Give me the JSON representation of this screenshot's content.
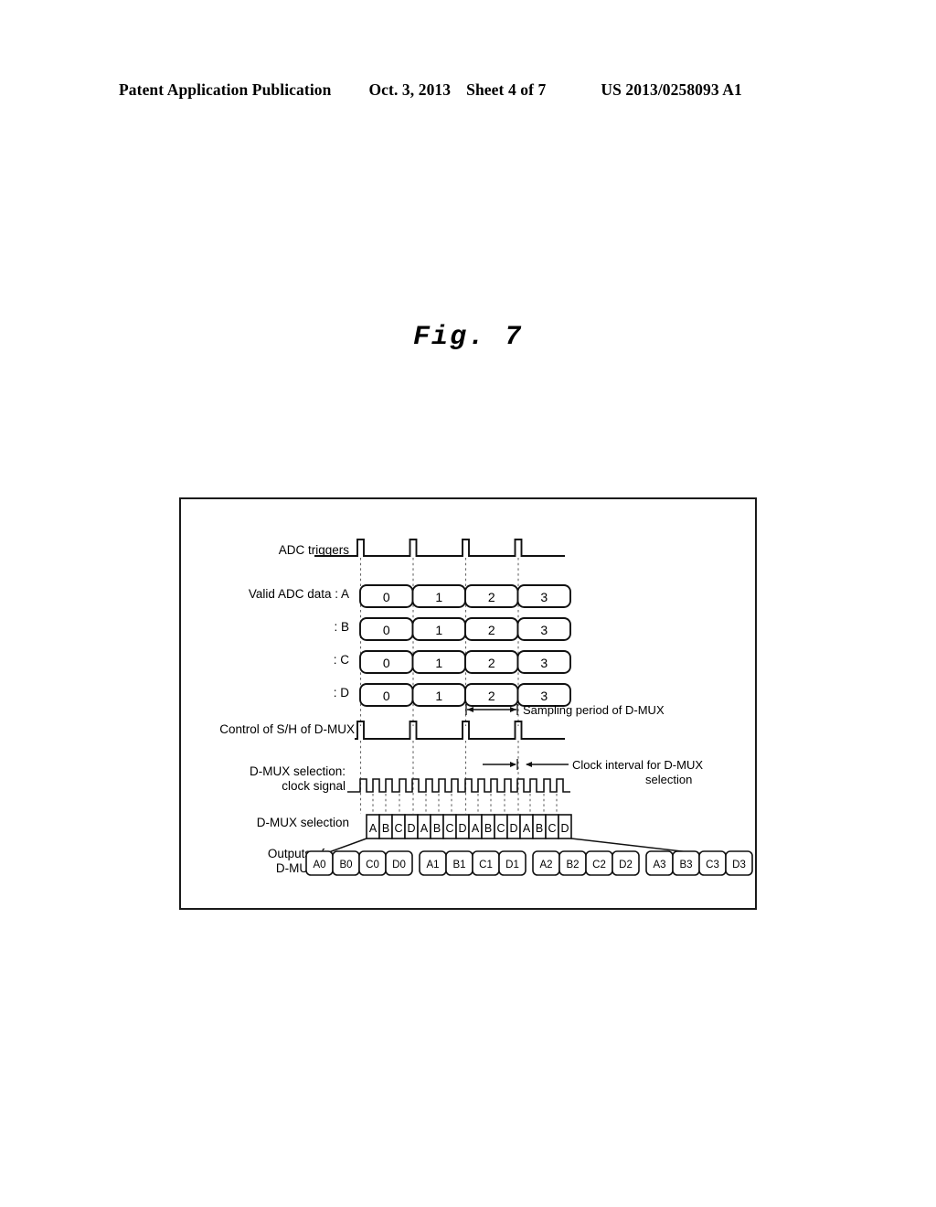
{
  "header": {
    "publication": "Patent Application Publication",
    "date": "Oct. 3, 2013",
    "sheet": "Sheet 4 of 7",
    "patent_number": "US 2013/0258093 A1"
  },
  "figure": {
    "title": "Fig.  7"
  },
  "diagram": {
    "rows": {
      "adc_triggers_label": "ADC triggers",
      "valid_adc_data_a_label": "Valid ADC data : A",
      "valid_adc_data_b_label": ": B",
      "valid_adc_data_c_label": ": C",
      "valid_adc_data_d_label": ": D",
      "control_sh_label": "Control of S/H of D-MUX",
      "dmux_clock_label_line1": "D-MUX selection:",
      "dmux_clock_label_line2": "clock signal",
      "dmux_selection_label": "D-MUX selection",
      "outputs_label_line1": "Outputs of",
      "outputs_label_line2": "D-MUX"
    },
    "annotations": {
      "sampling_period": "Sampling period of D-MUX",
      "clock_interval_line1": "Clock interval for D-MUX",
      "clock_interval_line2": "selection"
    },
    "adc_data_values": [
      "0",
      "1",
      "2",
      "3"
    ],
    "dmux_selection_sequence": [
      "A",
      "B",
      "C",
      "D",
      "A",
      "B",
      "C",
      "D",
      "A",
      "B",
      "C",
      "D",
      "A",
      "B",
      "C",
      "D"
    ],
    "dmux_outputs": [
      [
        "A0",
        "B0",
        "C0",
        "D0"
      ],
      [
        "A1",
        "B1",
        "C1",
        "D1"
      ],
      [
        "A2",
        "B2",
        "C2",
        "D2"
      ],
      [
        "A3",
        "B3",
        "C3",
        "D3"
      ]
    ],
    "adc_trigger_pulse_count": 4,
    "dmux_clock_pulse_count": 16,
    "colors": {
      "ink": "#111111",
      "guide": "#666666",
      "background": "#ffffff"
    }
  }
}
